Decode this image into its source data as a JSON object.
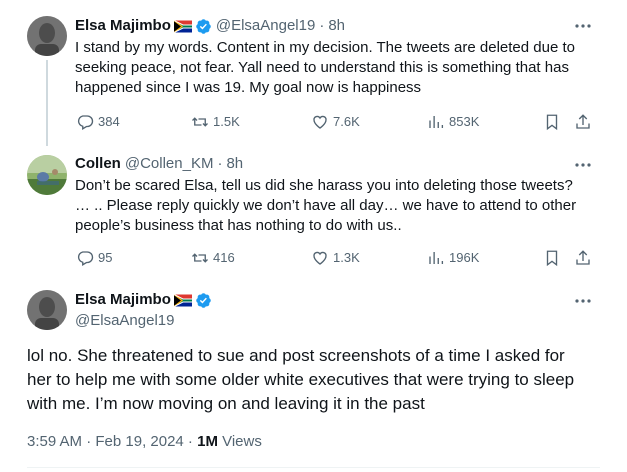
{
  "colors": {
    "accent": "#1d9bf0",
    "text": "#0f1419",
    "muted": "#536471",
    "line": "#cfd9de"
  },
  "tweets": [
    {
      "name": "Elsa Majimbo",
      "handle": "@ElsaAngel19",
      "separator": "·",
      "time": "8h",
      "text_lines": [
        "I stand by my words. Content in my decision. The tweets are deleted due to",
        "seeking peace, not fear. Yall need to understand this is something that has",
        "happened since I was 19. My goal now is happiness"
      ],
      "replies": "384",
      "retweets": "1.5K",
      "likes": "7.6K",
      "views": "853K"
    },
    {
      "name": "Collen",
      "handle": "@Collen_KM",
      "separator": "·",
      "time": "8h",
      "text_lines": [
        "Don’t be scared Elsa, tell us did she harass you into deleting those tweets?",
        "… .. Please reply quickly we don’t have all day… we have to attend to other",
        "people’s business that has nothing to do with us.."
      ],
      "replies": "95",
      "retweets": "416",
      "likes": "1.3K",
      "views": "196K"
    }
  ],
  "main": {
    "name": "Elsa Majimbo",
    "handle": "@ElsaAngel19",
    "text_lines": [
      "lol no. She threatened to sue and post screenshots of a time I asked for",
      "her to help me with some older white executives that were trying to sleep",
      "with me. I’m now moving on and leaving it in the past"
    ],
    "timestamp": "3:59 AM · Feb 19, 2024 · ",
    "views_count": "1M",
    "views_label": " Views"
  }
}
